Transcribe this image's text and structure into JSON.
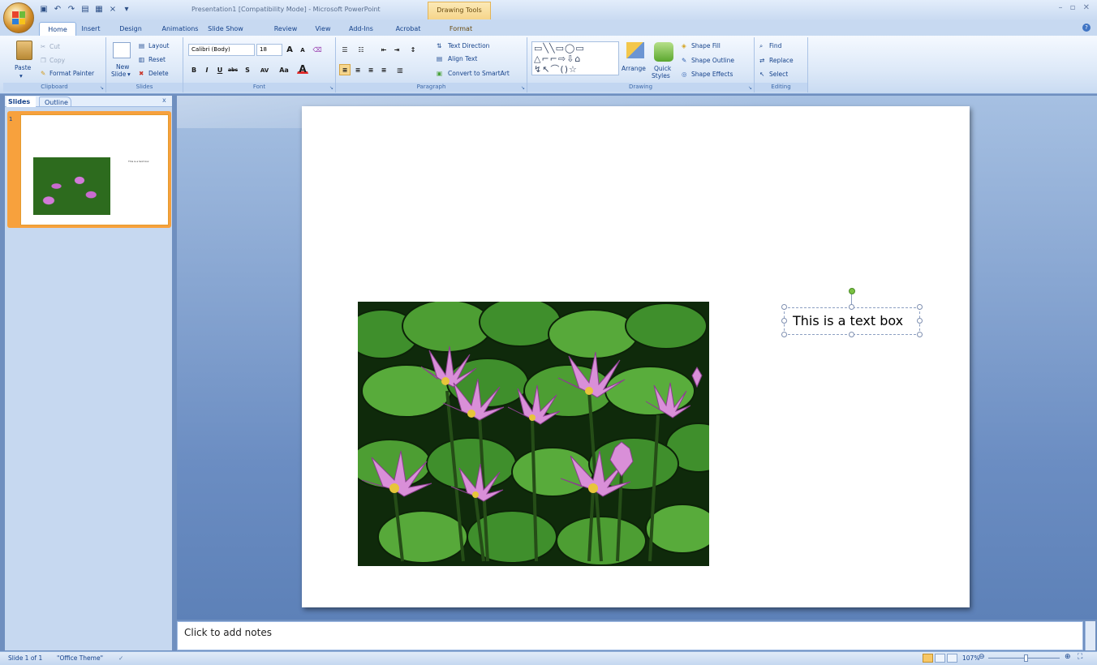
{
  "window": {
    "title": "Presentation1 [Compatibility Mode] - Microsoft PowerPoint",
    "contextual_tab": "Drawing Tools",
    "controls": "– ▫ ✕"
  },
  "tabs": [
    {
      "label": "Home",
      "active": true
    },
    {
      "label": "Insert"
    },
    {
      "label": "Design"
    },
    {
      "label": "Animations"
    },
    {
      "label": "Slide Show"
    },
    {
      "label": "Review"
    },
    {
      "label": "View"
    },
    {
      "label": "Add-Ins"
    },
    {
      "label": "Acrobat"
    },
    {
      "label": "Format",
      "contextual": true
    }
  ],
  "ribbon": {
    "clipboard": {
      "label": "Clipboard",
      "paste": "Paste",
      "cut": "Cut",
      "copy": "Copy",
      "format_painter": "Format Painter"
    },
    "slides": {
      "label": "Slides",
      "new_slide": "New",
      "new_slide_2": "Slide",
      "layout": "Layout",
      "reset": "Reset",
      "delete": "Delete"
    },
    "font": {
      "label": "Font",
      "font_name": "Calibri (Body)",
      "font_size": "18",
      "grow": "A",
      "shrink": "A",
      "bold": "B",
      "italic": "I",
      "underline": "U",
      "strike": "abc",
      "shadow": "S",
      "spacing": "AV",
      "case": "Aa",
      "color": "A"
    },
    "paragraph": {
      "label": "Paragraph",
      "text_direction": "Text Direction",
      "align_text": "Align Text",
      "convert_smartart": "Convert to SmartArt"
    },
    "drawing": {
      "label": "Drawing",
      "arrange": "Arrange",
      "quick_styles": "Quick",
      "quick_styles_2": "Styles",
      "shape_fill": "Shape Fill",
      "shape_outline": "Shape Outline",
      "shape_effects": "Shape Effects"
    },
    "editing": {
      "label": "Editing",
      "find": "Find",
      "replace": "Replace",
      "select": "Select"
    }
  },
  "slides_pane": {
    "tab_slides": "Slides",
    "tab_outline": "Outline",
    "close": "x",
    "thumb_number": "1",
    "thumb_text": "This is a text box"
  },
  "slide": {
    "text_box": "This is a text box"
  },
  "notes": {
    "placeholder": "Click to add notes"
  },
  "status": {
    "slide_info": "Slide 1 of 1",
    "theme": "\"Office Theme\"",
    "zoom": "107%",
    "zoom_fraction": 0.53
  },
  "colors": {
    "ribbon_text": "#15428b",
    "selection_orange": "#f7a13d",
    "edit_bg": "#6b8dc2"
  }
}
